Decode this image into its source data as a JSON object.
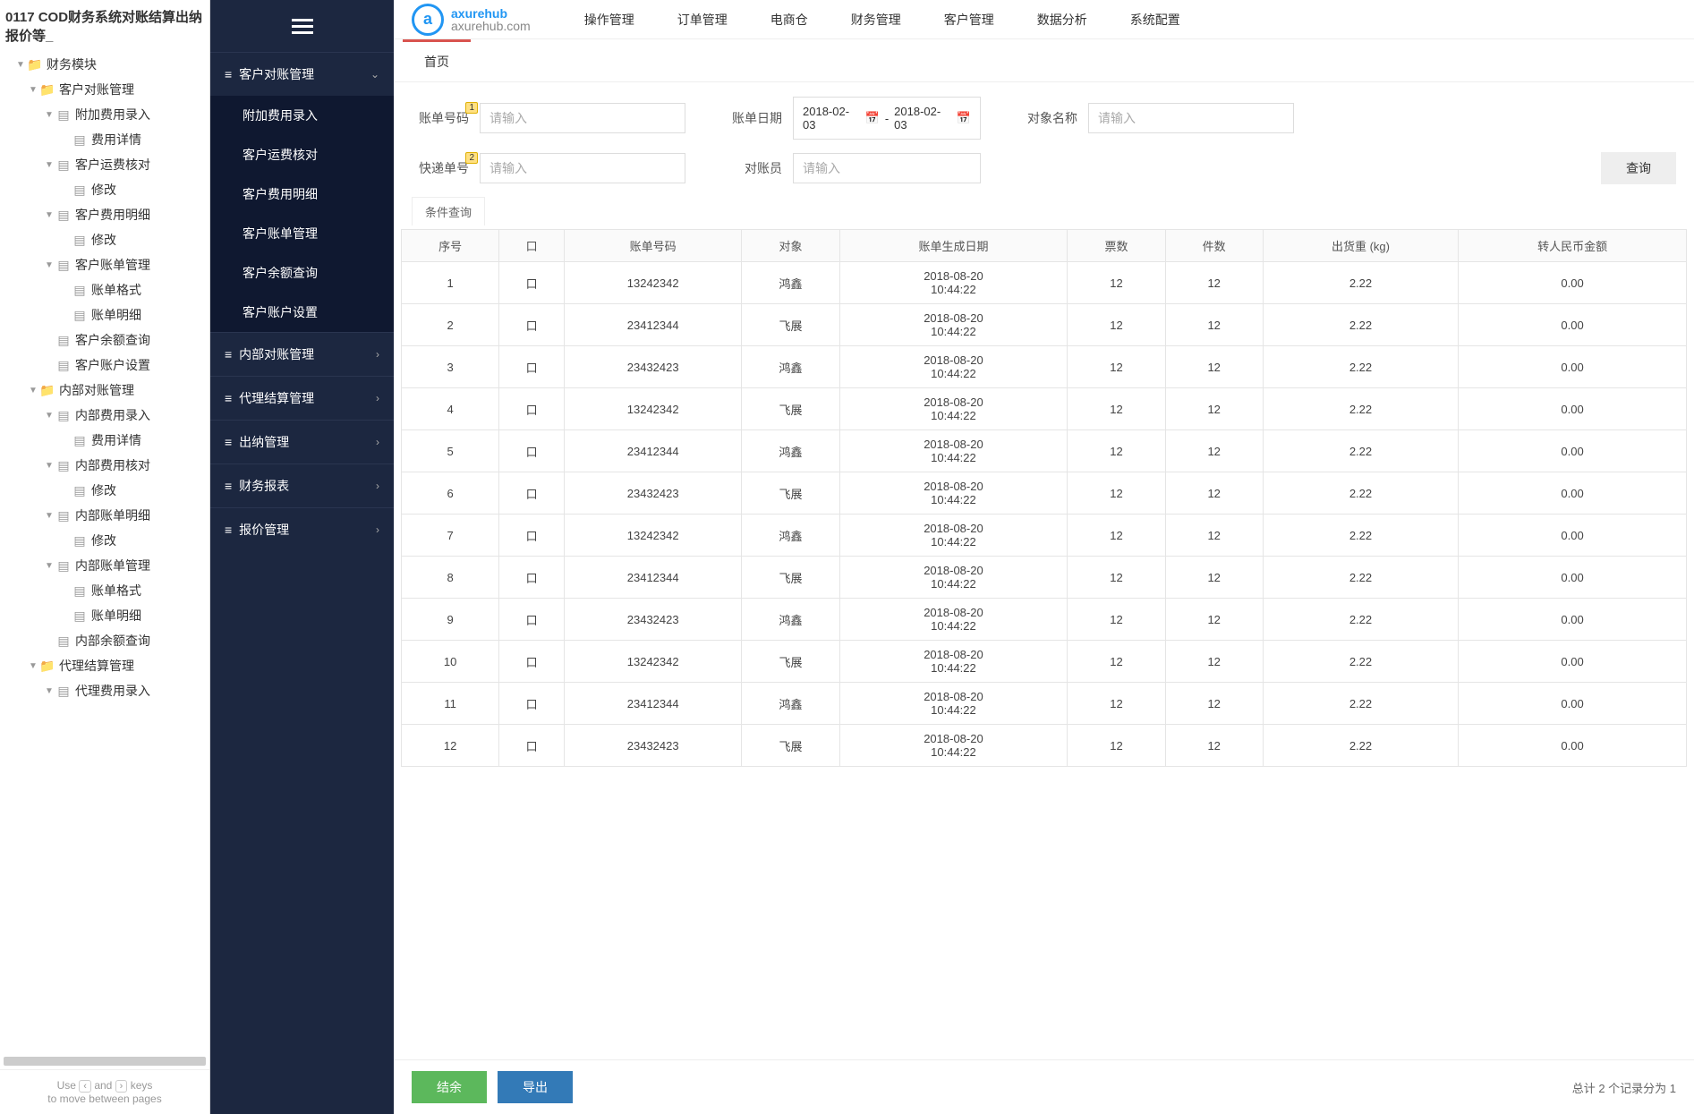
{
  "tree": {
    "title": "0117 COD财务系统对账结算出纳报价等_",
    "nodes": [
      {
        "indent": 1,
        "caret": "▼",
        "icon": "folder",
        "label": "财务模块"
      },
      {
        "indent": 2,
        "caret": "▼",
        "icon": "folder",
        "label": "客户对账管理"
      },
      {
        "indent": 3,
        "caret": "▼",
        "icon": "page",
        "label": "附加费用录入"
      },
      {
        "indent": 4,
        "caret": "",
        "icon": "page",
        "label": "费用详情"
      },
      {
        "indent": 3,
        "caret": "▼",
        "icon": "page",
        "label": "客户运费核对"
      },
      {
        "indent": 4,
        "caret": "",
        "icon": "page",
        "label": "修改"
      },
      {
        "indent": 3,
        "caret": "▼",
        "icon": "page",
        "label": "客户费用明细"
      },
      {
        "indent": 4,
        "caret": "",
        "icon": "page",
        "label": "修改"
      },
      {
        "indent": 3,
        "caret": "▼",
        "icon": "page",
        "label": "客户账单管理"
      },
      {
        "indent": 4,
        "caret": "",
        "icon": "page",
        "label": "账单格式"
      },
      {
        "indent": 4,
        "caret": "",
        "icon": "page",
        "label": "账单明细"
      },
      {
        "indent": 3,
        "caret": "",
        "icon": "page",
        "label": "客户余额查询"
      },
      {
        "indent": 3,
        "caret": "",
        "icon": "page",
        "label": "客户账户设置"
      },
      {
        "indent": 2,
        "caret": "▼",
        "icon": "folder",
        "label": "内部对账管理"
      },
      {
        "indent": 3,
        "caret": "▼",
        "icon": "page",
        "label": "内部费用录入"
      },
      {
        "indent": 4,
        "caret": "",
        "icon": "page",
        "label": "费用详情"
      },
      {
        "indent": 3,
        "caret": "▼",
        "icon": "page",
        "label": "内部费用核对"
      },
      {
        "indent": 4,
        "caret": "",
        "icon": "page",
        "label": "修改"
      },
      {
        "indent": 3,
        "caret": "▼",
        "icon": "page",
        "label": "内部账单明细"
      },
      {
        "indent": 4,
        "caret": "",
        "icon": "page",
        "label": "修改"
      },
      {
        "indent": 3,
        "caret": "▼",
        "icon": "page",
        "label": "内部账单管理"
      },
      {
        "indent": 4,
        "caret": "",
        "icon": "page",
        "label": "账单格式"
      },
      {
        "indent": 4,
        "caret": "",
        "icon": "page",
        "label": "账单明细"
      },
      {
        "indent": 3,
        "caret": "",
        "icon": "page",
        "label": "内部余额查询"
      },
      {
        "indent": 2,
        "caret": "▼",
        "icon": "folder",
        "label": "代理结算管理"
      },
      {
        "indent": 3,
        "caret": "▼",
        "icon": "page",
        "label": "代理费用录入"
      }
    ],
    "footer_line1_prefix": "Use ",
    "footer_key1": "‹",
    "footer_and": " and ",
    "footer_key2": "›",
    "footer_line1_suffix": " keys",
    "footer_line2": "to move between pages"
  },
  "logo": {
    "top": "axurehub",
    "bottom": "axurehub.com"
  },
  "topnav": [
    "操作管理",
    "订单管理",
    "电商仓",
    "财务管理",
    "客户管理",
    "数据分析",
    "系统配置"
  ],
  "sidebar": {
    "groups": [
      {
        "label": "客户对账管理",
        "expanded": true,
        "children": [
          "附加费用录入",
          "客户运费核对",
          "客户费用明细",
          "客户账单管理",
          "客户余额查询",
          "客户账户设置"
        ]
      },
      {
        "label": "内部对账管理",
        "expanded": false
      },
      {
        "label": "代理结算管理",
        "expanded": false
      },
      {
        "label": "出纳管理",
        "expanded": false
      },
      {
        "label": "财务报表",
        "expanded": false
      },
      {
        "label": "报价管理",
        "expanded": false
      }
    ]
  },
  "tab": {
    "home": "首页"
  },
  "filters": {
    "bill_no_label": "账单号码",
    "bill_no_badge": "1",
    "bill_no_placeholder": "请输入",
    "bill_date_label": "账单日期",
    "date_from": "2018-02-03",
    "date_sep": "-",
    "date_to": "2018-02-03",
    "object_label": "对象名称",
    "object_placeholder": "请输入",
    "express_no_label": "快递单号",
    "express_no_badge": "2",
    "express_no_placeholder": "请输入",
    "checker_label": "对账员",
    "checker_placeholder": "请输入",
    "search_btn": "查询",
    "cond_tab": "条件查询"
  },
  "table": {
    "headers": [
      "序号",
      "口",
      "账单号码",
      "对象",
      "账单生成日期",
      "票数",
      "件数",
      "出货重 (kg)",
      "转人民币金额"
    ],
    "rows": [
      {
        "seq": "1",
        "chk": "口",
        "bill": "13242342",
        "obj": "鸿鑫",
        "date": "2018-08-20 10:44:22",
        "tickets": "12",
        "pcs": "12",
        "wt": "2.22",
        "amt": "0.00"
      },
      {
        "seq": "2",
        "chk": "口",
        "bill": "23412344",
        "obj": "飞展",
        "date": "2018-08-20 10:44:22",
        "tickets": "12",
        "pcs": "12",
        "wt": "2.22",
        "amt": "0.00"
      },
      {
        "seq": "3",
        "chk": "口",
        "bill": "23432423",
        "obj": "鸿鑫",
        "date": "2018-08-20 10:44:22",
        "tickets": "12",
        "pcs": "12",
        "wt": "2.22",
        "amt": "0.00"
      },
      {
        "seq": "4",
        "chk": "口",
        "bill": "13242342",
        "obj": "飞展",
        "date": "2018-08-20 10:44:22",
        "tickets": "12",
        "pcs": "12",
        "wt": "2.22",
        "amt": "0.00"
      },
      {
        "seq": "5",
        "chk": "口",
        "bill": "23412344",
        "obj": "鸿鑫",
        "date": "2018-08-20 10:44:22",
        "tickets": "12",
        "pcs": "12",
        "wt": "2.22",
        "amt": "0.00"
      },
      {
        "seq": "6",
        "chk": "口",
        "bill": "23432423",
        "obj": "飞展",
        "date": "2018-08-20 10:44:22",
        "tickets": "12",
        "pcs": "12",
        "wt": "2.22",
        "amt": "0.00"
      },
      {
        "seq": "7",
        "chk": "口",
        "bill": "13242342",
        "obj": "鸿鑫",
        "date": "2018-08-20 10:44:22",
        "tickets": "12",
        "pcs": "12",
        "wt": "2.22",
        "amt": "0.00"
      },
      {
        "seq": "8",
        "chk": "口",
        "bill": "23412344",
        "obj": "飞展",
        "date": "2018-08-20 10:44:22",
        "tickets": "12",
        "pcs": "12",
        "wt": "2.22",
        "amt": "0.00"
      },
      {
        "seq": "9",
        "chk": "口",
        "bill": "23432423",
        "obj": "鸿鑫",
        "date": "2018-08-20 10:44:22",
        "tickets": "12",
        "pcs": "12",
        "wt": "2.22",
        "amt": "0.00"
      },
      {
        "seq": "10",
        "chk": "口",
        "bill": "13242342",
        "obj": "飞展",
        "date": "2018-08-20 10:44:22",
        "tickets": "12",
        "pcs": "12",
        "wt": "2.22",
        "amt": "0.00"
      },
      {
        "seq": "11",
        "chk": "口",
        "bill": "23412344",
        "obj": "鸿鑫",
        "date": "2018-08-20 10:44:22",
        "tickets": "12",
        "pcs": "12",
        "wt": "2.22",
        "amt": "0.00"
      },
      {
        "seq": "12",
        "chk": "口",
        "bill": "23432423",
        "obj": "飞展",
        "date": "2018-08-20 10:44:22",
        "tickets": "12",
        "pcs": "12",
        "wt": "2.22",
        "amt": "0.00"
      }
    ]
  },
  "bottom": {
    "settle": "结余",
    "export": "导出",
    "pager": "总计 2 个记录分为 1"
  }
}
